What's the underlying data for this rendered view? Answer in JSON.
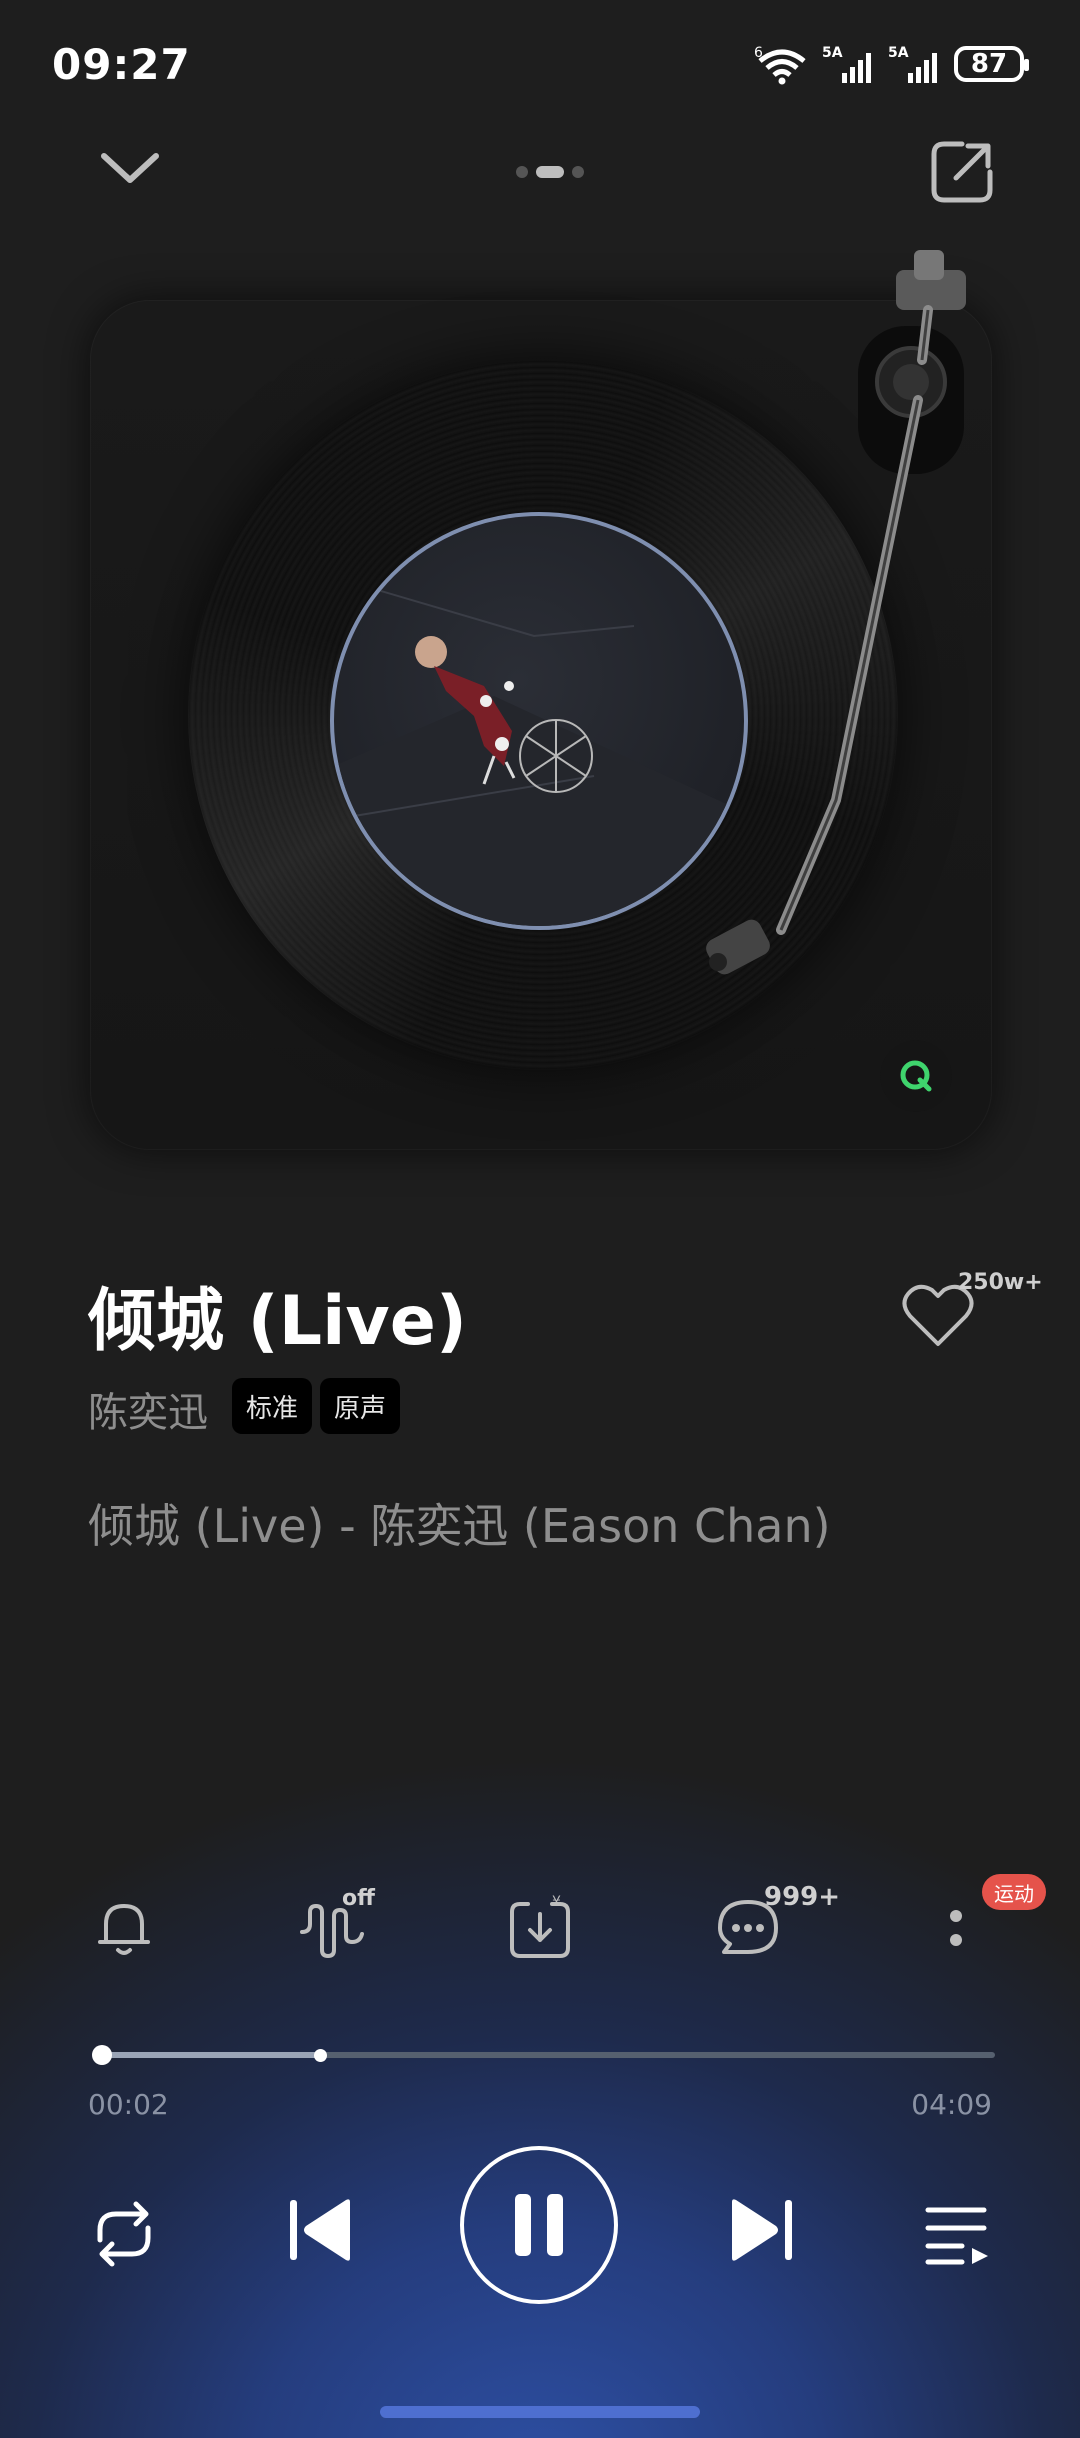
{
  "status_bar": {
    "time": "09:27",
    "network_1": "5A",
    "network_2": "5A",
    "wifi_label": "6",
    "battery": "87"
  },
  "header": {
    "collapse_icon": "chevron-down-icon",
    "share_icon": "share-icon",
    "page_indicator": {
      "count": 3,
      "active_index": 1
    }
  },
  "artwork": {
    "type": "vinyl-turntable",
    "badge_icon": "qq-music-q-icon",
    "badge_color": "#3fd46d"
  },
  "song": {
    "title": "倾城 (Live)",
    "artist": "陈奕迅",
    "tags": [
      "标准",
      "原声"
    ],
    "lyric": "倾城 (Live) - 陈奕迅 (Eason Chan)",
    "like_count": "250w+"
  },
  "actions": {
    "bell_icon": "bell-icon",
    "sound_effect_label": "off",
    "download_icon": "paid-download-icon",
    "comment_count": "999+",
    "more_badge": "运动"
  },
  "progress": {
    "elapsed": "00:02",
    "duration": "04:09",
    "played_fraction": 0.008,
    "buffered_fraction": 0.25
  },
  "controls": {
    "repeat_icon": "repeat-icon",
    "prev_icon": "previous-icon",
    "play_state": "playing",
    "next_icon": "next-icon",
    "playlist_icon": "playlist-icon"
  },
  "colors": {
    "background": "#1e1e1e",
    "accent_blue": "#2d4fa3",
    "badge_red": "#e5534b",
    "muted_text": "#8e8e8e"
  }
}
